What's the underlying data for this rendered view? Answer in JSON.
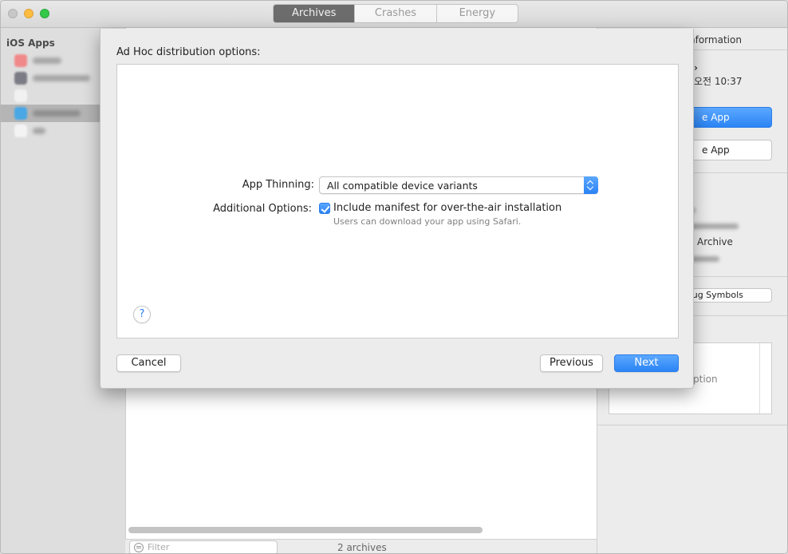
{
  "window": {
    "tabs": [
      {
        "label": "Archives",
        "active": true
      },
      {
        "label": "Crashes",
        "active": false
      },
      {
        "label": "Energy",
        "active": false
      }
    ]
  },
  "sidebar": {
    "header": "iOS Apps"
  },
  "center": {
    "filter_placeholder": "Filter",
    "archive_count": "2 archives"
  },
  "inspector": {
    "section_title_fragment": "nformation",
    "time_fragment": "오전 10:37",
    "primary_button_fragment": "e App",
    "secondary_button_fragment": "e App",
    "archive_fragment": "Archive",
    "debug_symbols_fragment": "oug Symbols",
    "option_fragment": "ption"
  },
  "sheet": {
    "title": "Ad Hoc distribution options:",
    "app_thinning_label": "App Thinning:",
    "app_thinning_value": "All compatible device variants",
    "additional_options_label": "Additional Options:",
    "manifest_checkbox_label": "Include manifest for over-the-air installation",
    "manifest_checked": true,
    "manifest_help": "Users can download your app using Safari.",
    "help_glyph": "?",
    "cancel_label": "Cancel",
    "previous_label": "Previous",
    "next_label": "Next"
  },
  "colors": {
    "accent": "#2b84f5",
    "window_bg": "#ececec"
  }
}
